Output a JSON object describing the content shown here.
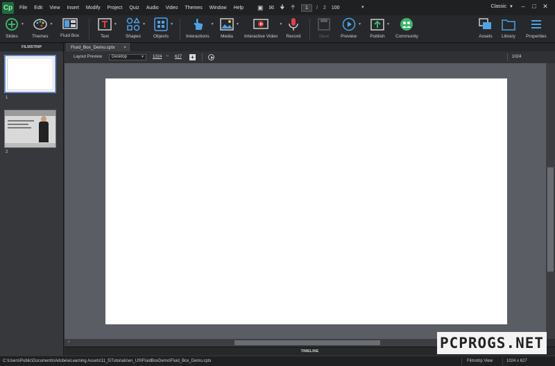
{
  "app": {
    "logo_text": "Cp",
    "mode_label": "Classic",
    "menu": [
      "File",
      "Edit",
      "View",
      "Insert",
      "Modify",
      "Project",
      "Quiz",
      "Audio",
      "Video",
      "Themes",
      "Window",
      "Help"
    ],
    "current_slide": "1",
    "slide_separator": "/",
    "total_slides": "2",
    "zoom": "100",
    "window_controls": [
      "minimize-icon",
      "maximize-icon",
      "close-icon"
    ]
  },
  "toolbar": {
    "slides": "Slides",
    "themes": "Themes",
    "fluid_box": "Fluid Box",
    "text": "Text",
    "shapes": "Shapes",
    "objects": "Objects",
    "interactions": "Interactions",
    "media": "Media",
    "interactive_video": "Interactive Video",
    "record": "Record",
    "save": "Save",
    "preview": "Preview",
    "publish": "Publish",
    "community": "Community",
    "assets": "Assets",
    "library": "Library",
    "properties": "Properties",
    "icon_color_blue": "#4ea3e6",
    "icon_color_green": "#3fb36b"
  },
  "filmstrip": {
    "title": "FILMSTRIP",
    "slides": [
      {
        "number": "1",
        "selected": true
      },
      {
        "number": "2",
        "selected": false
      }
    ],
    "selection_color": "#6b8ccf"
  },
  "document": {
    "tab_name": "Fluid_Box_Demo.cptx",
    "close_glyph": "×"
  },
  "layout_preview": {
    "label": "Layout Preview",
    "device": "Desktop",
    "width": "1024",
    "height": "627",
    "ruler_value": "1024"
  },
  "timeline": {
    "label": "TIMELINE"
  },
  "status": {
    "path": "C:\\Users\\Public\\Documents\\Adobe\\eLearning Assets\\11_5\\Tutorials\\en_US\\FluidBoxDemo\\Fluid_Box_Demo.cptx",
    "view": "Filmstrip View",
    "size": "1024 x 627"
  },
  "watermark": {
    "text": "PCPROGS.NET"
  }
}
